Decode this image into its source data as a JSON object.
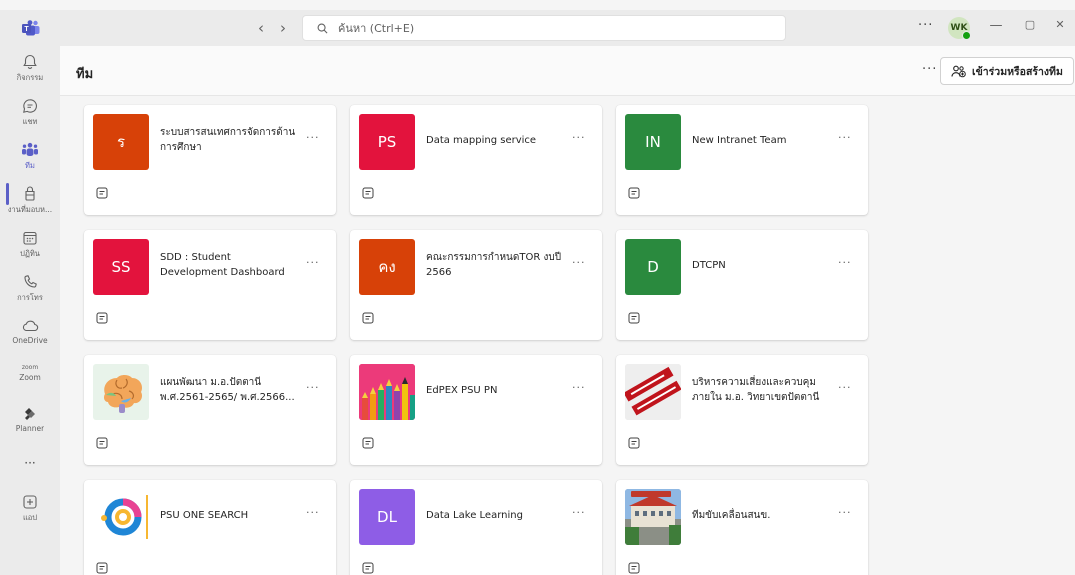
{
  "window": {
    "search_placeholder": "ค้นหา (Ctrl+E)",
    "user_initials": "WK",
    "more_symbol": "···",
    "back_symbol": "‹",
    "forward_symbol": "›",
    "minimize_symbol": "—",
    "restore_symbol": "▢",
    "close_symbol": "✕"
  },
  "rail": {
    "items": [
      {
        "label": "กิจกรรม",
        "icon": "bell-icon"
      },
      {
        "label": "แชท",
        "icon": "chat-icon"
      },
      {
        "label": "ทีม",
        "icon": "teams-icon",
        "active": true
      },
      {
        "label": "งานที่มอบห...",
        "icon": "assignments-icon"
      },
      {
        "label": "ปฏิทิน",
        "icon": "calendar-icon"
      },
      {
        "label": "การโทร",
        "icon": "phone-icon"
      },
      {
        "label": "OneDrive",
        "icon": "cloud-icon"
      },
      {
        "label": "Zoom",
        "icon": "zoom-icon",
        "sublabel": "zoom"
      },
      {
        "label": "Planner",
        "icon": "planner-icon"
      },
      {
        "label": "···",
        "icon": "more-icon"
      },
      {
        "label": "แอป",
        "icon": "apps-icon"
      }
    ]
  },
  "header": {
    "title": "ทีม",
    "more_symbol": "···",
    "join_label": "เข้าร่วมหรือสร้างทีม"
  },
  "teams": [
    {
      "name": "ระบบสารสนเทศการจัดการด้านการศึกษา",
      "initials": "ร",
      "color": "#d74108"
    },
    {
      "name": "Data mapping service",
      "initials": "PS",
      "color": "#e3133d"
    },
    {
      "name": "New Intranet Team",
      "initials": "IN",
      "color": "#2a8a3e"
    },
    {
      "name": "SDD : Student Development Dashboard",
      "initials": "SS",
      "color": "#e3133d"
    },
    {
      "name": "คณะกรรมการกำหนดTOR งบปี 2566",
      "initials": "คง",
      "color": "#d74108"
    },
    {
      "name": "DTCPN",
      "initials": "D",
      "color": "#2a8a3e"
    },
    {
      "name": "แผนพัฒนา ม.อ.ปัตตานี พ.ศ.2561-2565/ พ.ศ.2566...",
      "initials": "",
      "color": "#e8f3ea",
      "image": "brain-image"
    },
    {
      "name": "EdPEX PSU PN",
      "initials": "",
      "color": "#ec3a7a",
      "image": "pencils-image"
    },
    {
      "name": "บริหารความเสี่ยงและควบคุมภายใน ม.อ. วิทยาเขตปัตตานี",
      "initials": "",
      "color": "#e9e9e9",
      "image": "risk-management-image"
    },
    {
      "name": "PSU ONE SEARCH",
      "initials": "",
      "color": "#ffffff",
      "image": "psu-one-search-logo"
    },
    {
      "name": "Data Lake Learning",
      "initials": "DL",
      "color": "#8e5de6"
    },
    {
      "name": "ทีมขับเคลื่อนสนข.",
      "initials": "",
      "color": "#7aa7d6",
      "image": "building-photo"
    }
  ],
  "colors": {
    "accent": "#5b5fc7",
    "presence": "#13a10e"
  }
}
